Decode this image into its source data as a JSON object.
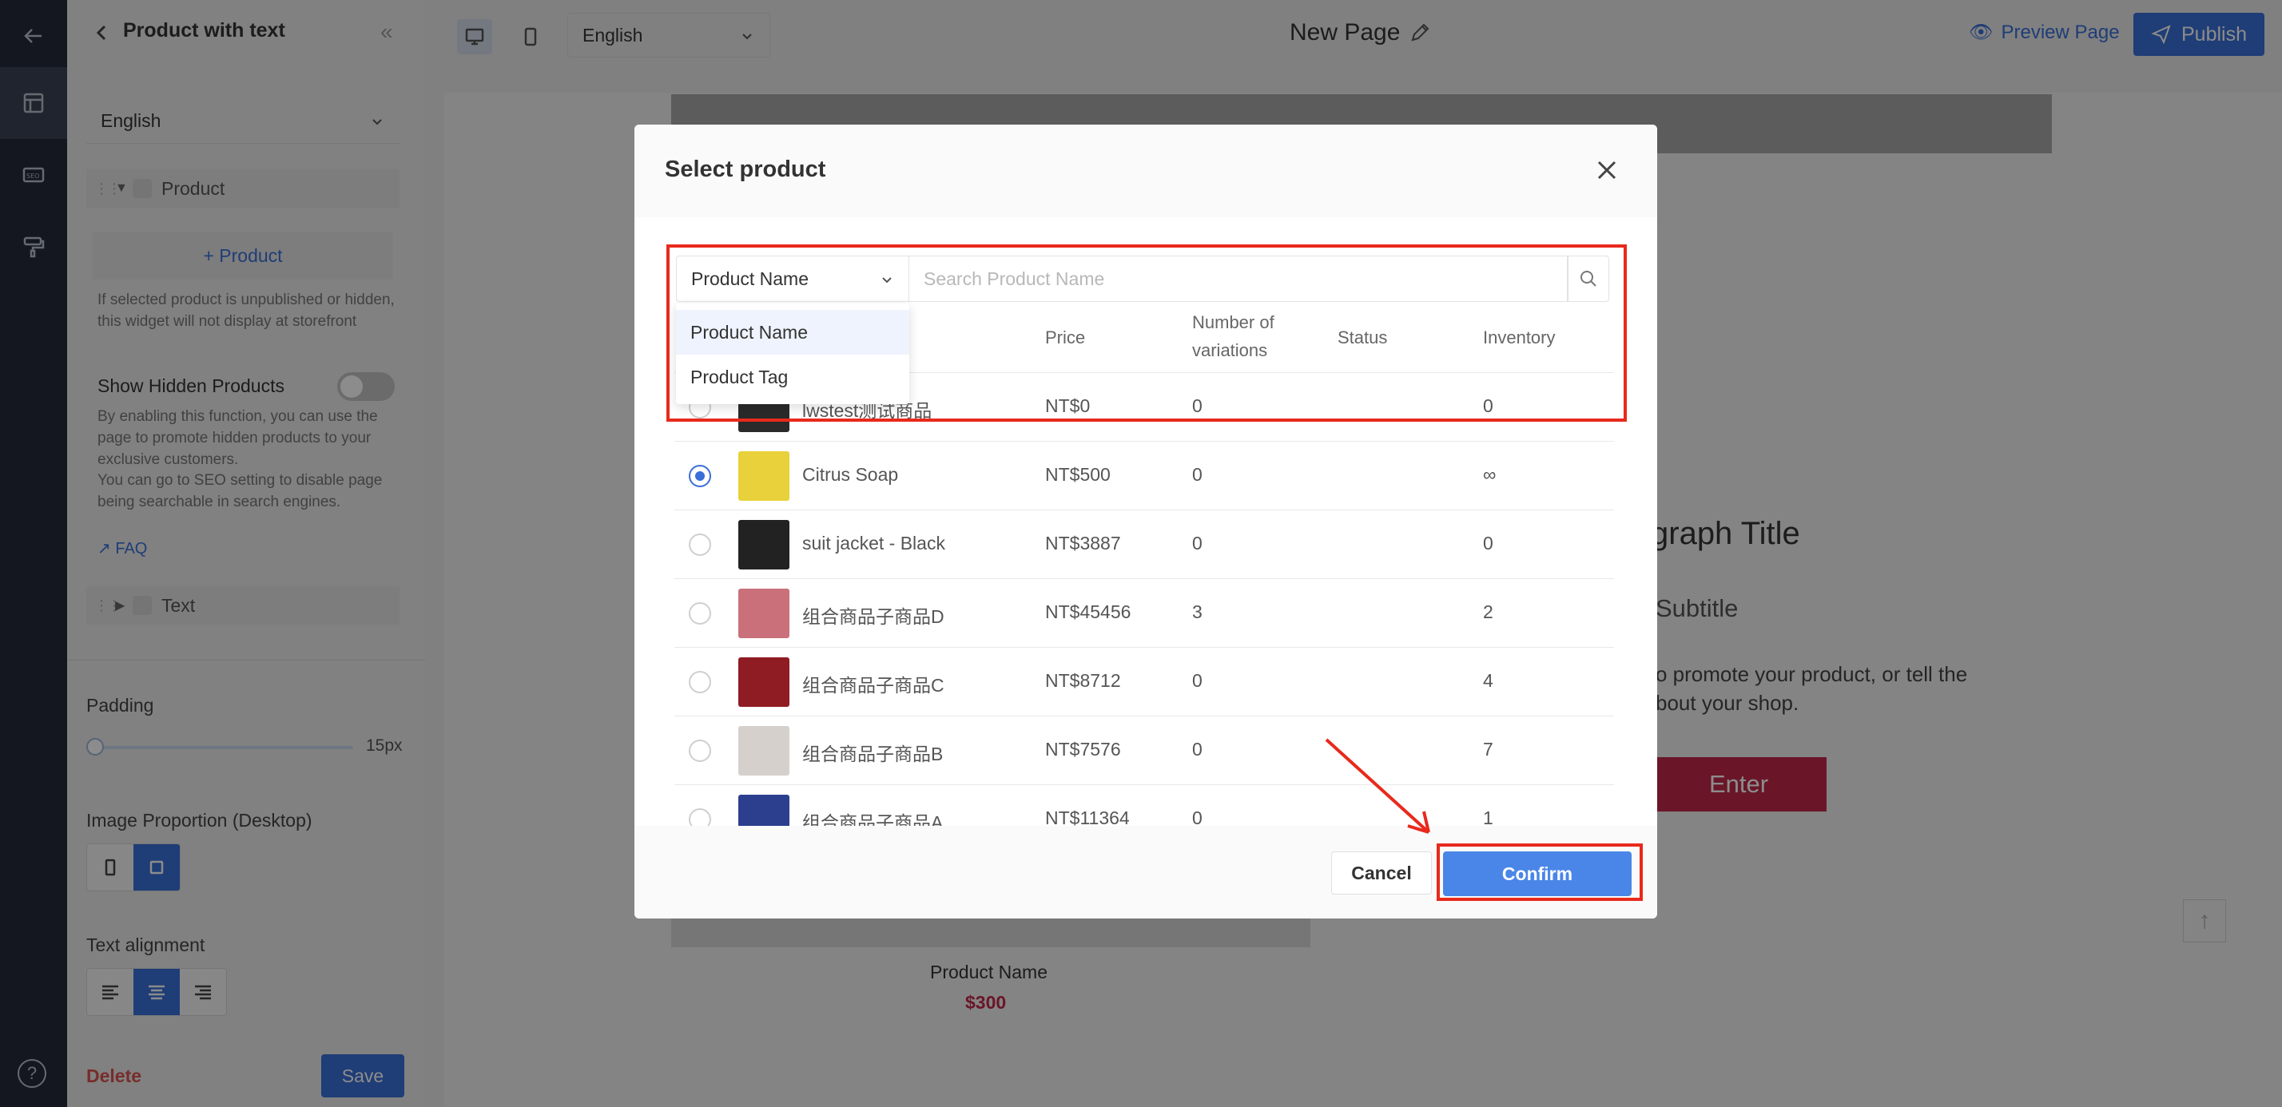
{
  "sidebar": {
    "title": "Product with text",
    "language": "English",
    "tree": {
      "product_label": "Product",
      "text_label": "Text"
    },
    "add_product_label": "+ Product",
    "product_hint": "If selected product is unpublished or hidden, this widget will not display at storefront",
    "show_hidden_label": "Show Hidden Products",
    "show_hidden_on": false,
    "show_hidden_hint": "By enabling this function, you can use the page to promote hidden products to your exclusive customers.",
    "seo_hint": "You can go to SEO setting to disable page being searchable in search engines.",
    "faq_label": "FAQ",
    "padding_label": "Padding",
    "padding_value": "15px",
    "image_proportion_label": "Image Proportion (Desktop)",
    "text_alignment_label": "Text alignment",
    "delete_label": "Delete",
    "save_label": "Save"
  },
  "topbar": {
    "language": "English",
    "page_title": "New Page",
    "preview_label": "Preview Page",
    "publish_label": "Publish"
  },
  "canvas": {
    "paragraph_title": "graph Title",
    "subtitle": "Subtitle",
    "body_line1": "o promote your product, or tell the",
    "body_line2": "bout your shop.",
    "button_label": "Enter",
    "product_name": "Product Name",
    "product_price": "$300"
  },
  "modal": {
    "title": "Select product",
    "filter_selected": "Product Name",
    "search_placeholder": "Search Product Name",
    "filter_options": [
      "Product Name",
      "Product Tag"
    ],
    "columns": {
      "price": "Price",
      "variations_line1": "Number of",
      "variations_line2": "variations",
      "status": "Status",
      "inventory": "Inventory"
    },
    "rows": [
      {
        "name": "lwstest测试商品",
        "price": "NT$0",
        "variations": "0",
        "status": "",
        "inventory": "0",
        "selected": false,
        "thumb_color": "#2a2a2a"
      },
      {
        "name": "Citrus Soap",
        "price": "NT$500",
        "variations": "0",
        "status": "",
        "inventory": "∞",
        "selected": true,
        "thumb_color": "#e8d13a"
      },
      {
        "name": "suit jacket - Black",
        "price": "NT$3887",
        "variations": "0",
        "status": "",
        "inventory": "0",
        "selected": false,
        "thumb_color": "#222222"
      },
      {
        "name": "组合商品子商品D",
        "price": "NT$45456",
        "variations": "3",
        "status": "",
        "inventory": "2",
        "selected": false,
        "thumb_color": "#c9707a"
      },
      {
        "name": "组合商品子商品C",
        "price": "NT$8712",
        "variations": "0",
        "status": "",
        "inventory": "4",
        "selected": false,
        "thumb_color": "#8e1c22"
      },
      {
        "name": "组合商品子商品B",
        "price": "NT$7576",
        "variations": "0",
        "status": "",
        "inventory": "7",
        "selected": false,
        "thumb_color": "#d6d0cc"
      },
      {
        "name": "组合商品子商品A",
        "price": "NT$11364",
        "variations": "0",
        "status": "",
        "inventory": "1",
        "selected": false,
        "thumb_color": "#2b3f8e"
      }
    ],
    "cancel_label": "Cancel",
    "confirm_label": "Confirm"
  },
  "colors": {
    "accent": "#3a6fd8",
    "confirm": "#4a86e8",
    "highlight": "#e8291c",
    "brand_button": "#c2284a",
    "rail": "#252b3b"
  }
}
